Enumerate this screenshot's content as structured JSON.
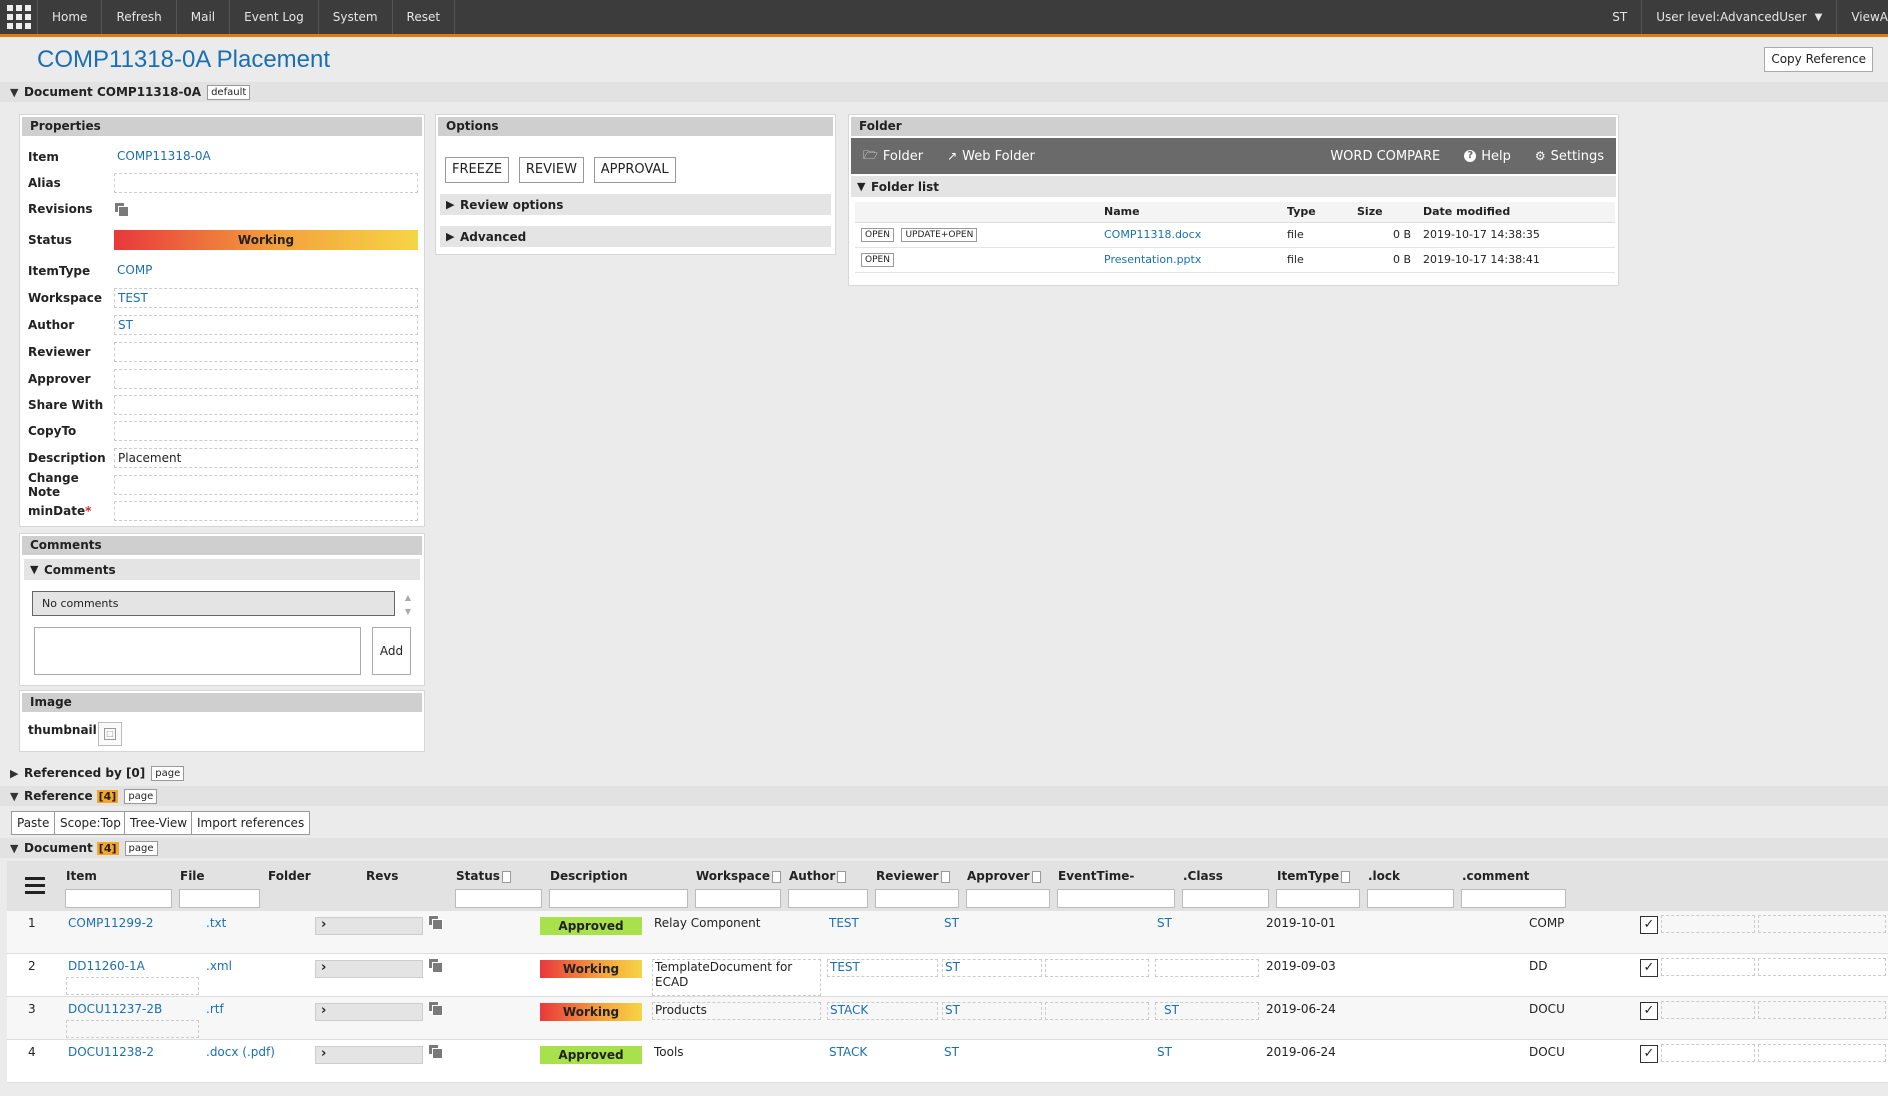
{
  "topbar": {
    "nav": [
      "Home",
      "Refresh",
      "Mail",
      "Event Log",
      "System",
      "Reset"
    ],
    "user_initials": "ST",
    "user_level": "User level:AdvancedUser",
    "view_label": "ViewA"
  },
  "page": {
    "title": "COMP11318-0A Placement",
    "copy_reference": "Copy Reference"
  },
  "document_section": {
    "label": "Document COMP11318-0A",
    "tag": "default"
  },
  "properties": {
    "header": "Properties",
    "item": {
      "label": "Item",
      "value": "COMP11318-0A"
    },
    "alias": {
      "label": "Alias",
      "value": ""
    },
    "revisions": {
      "label": "Revisions"
    },
    "status": {
      "label": "Status",
      "value": "Working"
    },
    "itemtype": {
      "label": "ItemType",
      "value": "COMP"
    },
    "workspace": {
      "label": "Workspace",
      "value": "TEST"
    },
    "author": {
      "label": "Author",
      "value": "ST"
    },
    "reviewer": {
      "label": "Reviewer",
      "value": ""
    },
    "approver": {
      "label": "Approver",
      "value": ""
    },
    "share_with": {
      "label": "Share With",
      "value": ""
    },
    "copy_to": {
      "label": "CopyTo",
      "value": ""
    },
    "description": {
      "label": "Description",
      "value": "Placement"
    },
    "change_note": {
      "label": "Change Note",
      "value": ""
    },
    "min_date": {
      "label": "minDate",
      "required_mark": "*",
      "value": ""
    }
  },
  "comments": {
    "header": "Comments",
    "sub_header": "Comments",
    "empty_text": "No comments",
    "add_button": "Add"
  },
  "image": {
    "header": "Image",
    "thumbnail_label": "thumbnail"
  },
  "options": {
    "header": "Options",
    "buttons": [
      "FREEZE",
      "REVIEW",
      "APPROVAL"
    ],
    "review_options": "Review options",
    "advanced": "Advanced"
  },
  "folder": {
    "header": "Folder",
    "toolbar": {
      "folder": "Folder",
      "web_folder": "Web Folder",
      "word_compare": "WORD COMPARE",
      "help": "Help",
      "settings": "Settings"
    },
    "list_header": "Folder list",
    "columns": {
      "name": "Name",
      "type": "Type",
      "size": "Size",
      "modified": "Date modified"
    },
    "open_label": "OPEN",
    "update_open_label": "UPDATE+OPEN",
    "files": [
      {
        "name": "COMP11318.docx",
        "type": "file",
        "size": "0 B",
        "modified": "2019-10-17 14:38:35"
      },
      {
        "name": "Presentation.pptx",
        "type": "file",
        "size": "0 B",
        "modified": "2019-10-17 14:38:41"
      }
    ]
  },
  "referenced_by": {
    "label": "Referenced by [0]",
    "tag": "page"
  },
  "reference": {
    "label": "Reference",
    "count": "[4]",
    "tag": "page"
  },
  "reference_buttons": {
    "paste": "Paste",
    "scope": "Scope:Top",
    "tree_view": "Tree-View",
    "import": "Import references"
  },
  "documents": {
    "label": "Document",
    "count": "[4]",
    "tag": "page",
    "columns": {
      "item": "Item",
      "file": "File",
      "folder": "Folder",
      "revs": "Revs",
      "status": "Status",
      "description": "Description",
      "workspace": "Workspace",
      "author": "Author",
      "reviewer": "Reviewer",
      "approver": "Approver",
      "eventtime": "EventTime-",
      "class": ".Class",
      "itemtype": "ItemType",
      "lock": ".lock",
      "comment": ".comment"
    },
    "rows": [
      {
        "num": "1",
        "item": "COMP11299-2",
        "file": ".txt",
        "status": "Approved",
        "description": "Relay Component",
        "workspace": "TEST",
        "author": "ST",
        "approver": "ST",
        "eventtime": "2019-10-01",
        "itemtype": "COMP",
        "lock": "✓"
      },
      {
        "num": "2",
        "item": "DD11260-1A",
        "file": ".xml",
        "status": "Working",
        "description": "TemplateDocument for ECAD",
        "workspace": "TEST",
        "author": "ST",
        "approver": "",
        "eventtime": "2019-09-03",
        "itemtype": "DD",
        "lock": "✓"
      },
      {
        "num": "3",
        "item": "DOCU11237-2B",
        "file": ".rtf",
        "status": "Working",
        "description": "Products",
        "workspace": "STACK",
        "author": "ST",
        "approver": "ST",
        "eventtime": "2019-06-24",
        "itemtype": "DOCU",
        "lock": "✓"
      },
      {
        "num": "4",
        "item": "DOCU11238-2",
        "file": ".docx (.pdf)",
        "status": "Approved",
        "description": "Tools",
        "workspace": "STACK",
        "author": "ST",
        "approver": "ST",
        "eventtime": "2019-06-24",
        "itemtype": "DOCU",
        "lock": "✓"
      }
    ]
  }
}
